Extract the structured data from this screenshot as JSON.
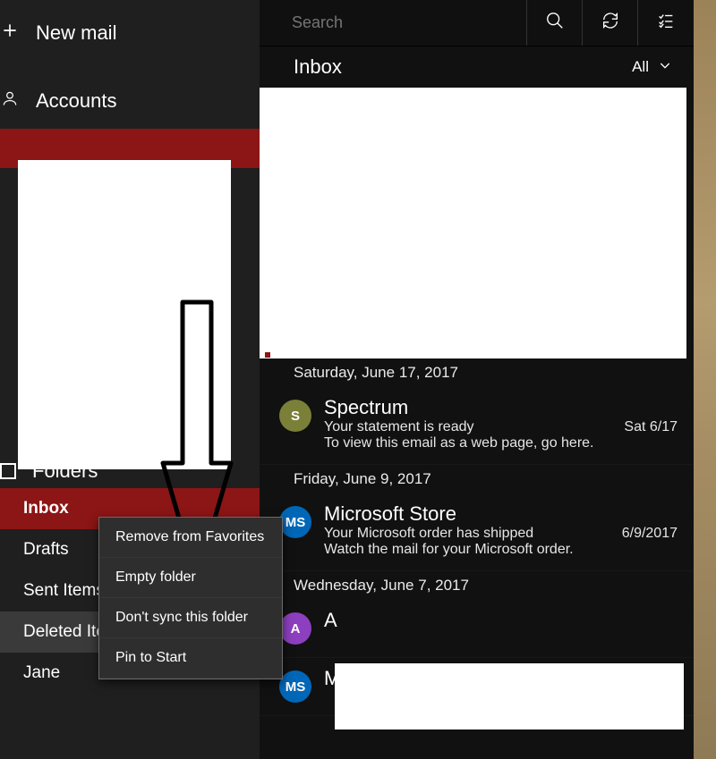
{
  "sidebar": {
    "new_mail": "New mail",
    "accounts": "Accounts",
    "folders_header": "Folders",
    "folders": [
      {
        "label": "Inbox",
        "state": "active"
      },
      {
        "label": "Drafts",
        "state": ""
      },
      {
        "label": "Sent Items",
        "state": ""
      },
      {
        "label": "Deleted Items",
        "state": "hover"
      },
      {
        "label": "Jane",
        "state": ""
      }
    ]
  },
  "context_menu": {
    "items": [
      "Remove from Favorites",
      "Empty folder",
      "Don't sync this folder",
      "Pin to Start"
    ]
  },
  "search": {
    "placeholder": "Search"
  },
  "inbox_header": {
    "title": "Inbox",
    "filter": "All"
  },
  "messages": [
    {
      "date_sep": "Saturday, June 17, 2017",
      "avatar_text": "S",
      "avatar_class": "av-green",
      "sender": "Spectrum",
      "subject": "Your statement is ready",
      "date": "Sat 6/17",
      "preview": "To view this email as a web page, go here."
    },
    {
      "date_sep": "Friday, June 9, 2017",
      "avatar_text": "MS",
      "avatar_class": "av-blue",
      "sender": "Microsoft Store",
      "subject": "Your Microsoft order has shipped",
      "date": "6/9/2017",
      "preview": "Watch the mail for your Microsoft order."
    },
    {
      "date_sep": "Wednesday, June 7, 2017",
      "avatar_text": "A",
      "avatar_class": "av-purple",
      "sender": "A",
      "subject": "",
      "date": "",
      "preview": ""
    },
    {
      "date_sep": "",
      "avatar_text": "MS",
      "avatar_class": "av-blue",
      "sender": "Microsoft Store",
      "subject": "",
      "date": "",
      "preview": ""
    }
  ],
  "colors": {
    "accent": "#8c1515"
  }
}
